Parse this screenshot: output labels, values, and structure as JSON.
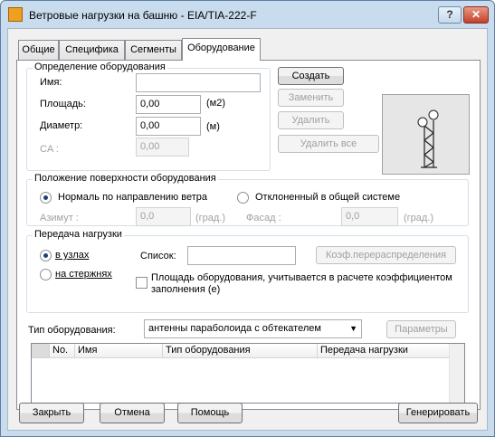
{
  "window": {
    "title": "Ветровые нагрузки на башню - EIA/TIA-222-F",
    "help": "?",
    "close": "✕"
  },
  "tabs": [
    "Общие",
    "Специфика",
    "Сегменты",
    "Оборудование"
  ],
  "definition": {
    "legend": "Определение оборудования",
    "name_label": "Имя:",
    "name_value": "",
    "area_label": "Площадь:",
    "area_value": "0,00",
    "area_unit": "(м2)",
    "diameter_label": "Диаметр:",
    "diameter_value": "0,00",
    "diameter_unit": "(м)",
    "ca_label": "CA :",
    "ca_value": "0,00",
    "create": "Создать",
    "replace": "Заменить",
    "delete": "Удалить",
    "delete_all": "Удалить все"
  },
  "surface": {
    "legend": "Положение поверхности оборудования",
    "normal": "Нормаль по направлению ветра",
    "deflected": "Отклоненный в общей системе",
    "azimuth_label": "Азимут :",
    "azimuth_value": "0,0",
    "azimuth_unit": "(град.)",
    "facade_label": "Фасад :",
    "facade_value": "0,0",
    "facade_unit": "(град.)"
  },
  "transfer": {
    "legend": "Передача нагрузки",
    "in_nodes": "в узлах",
    "on_bars": "на стержнях",
    "list_label": "Список:",
    "list_value": "",
    "redistribution": "Коэф.перераспределения",
    "area_note": "Площадь оборудования, учитывается в расчете коэффициентом заполнения (е)"
  },
  "equipment_type": {
    "label": "Тип оборудования:",
    "value": "антенны параболоида с обтекателем",
    "params": "Параметры"
  },
  "table": {
    "columns": [
      "No.",
      "Имя",
      "Тип оборудования",
      "Передача нагрузки"
    ]
  },
  "footer": {
    "close": "Закрыть",
    "cancel": "Отмена",
    "help": "Помощь",
    "generate": "Генерировать"
  }
}
